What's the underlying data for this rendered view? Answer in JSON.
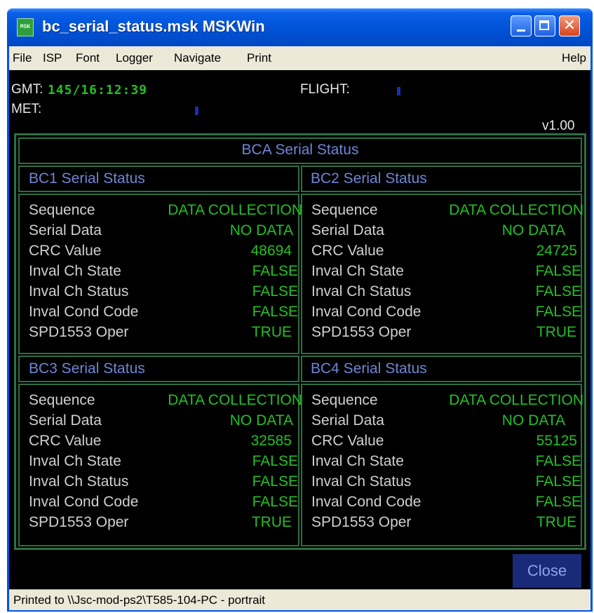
{
  "window": {
    "title": "bc_serial_status.msk MSKWin"
  },
  "menu": {
    "file": "File",
    "isp": "ISP",
    "font": "Font",
    "logger": "Logger",
    "navigate": "Navigate",
    "print": "Print",
    "help": "Help"
  },
  "header": {
    "gmt_label": "GMT:",
    "gmt_value": "145/16:12:39",
    "flight_label": "FLIGHT:",
    "met_label": "MET:",
    "version": "v1.00"
  },
  "panel": {
    "title": "BCA Serial Status",
    "labels": {
      "sequence": "Sequence",
      "serial_data": "Serial Data",
      "crc_value": "CRC Value",
      "inval_ch_state": "Inval Ch State",
      "inval_ch_status": "Inval Ch Status",
      "inval_cond_code": "Inval Cond Code",
      "spd1553_oper": "SPD1553 Oper"
    },
    "sections": [
      {
        "title": "BC1 Serial Status",
        "sequence": "DATA COLLECTION",
        "serial_data": "NO DATA",
        "crc_value": "48694",
        "inval_ch_state": "FALSE",
        "inval_ch_status": "FALSE",
        "inval_cond_code": "FALSE",
        "spd1553_oper": "TRUE"
      },
      {
        "title": "BC2 Serial Status",
        "sequence": "DATA COLLECTION",
        "serial_data": "NO DATA",
        "crc_value": "24725",
        "inval_ch_state": "FALSE",
        "inval_ch_status": "FALSE",
        "inval_cond_code": "FALSE",
        "spd1553_oper": "TRUE"
      },
      {
        "title": "BC3 Serial Status",
        "sequence": "DATA COLLECTION",
        "serial_data": "NO DATA",
        "crc_value": "32585",
        "inval_ch_state": "FALSE",
        "inval_ch_status": "FALSE",
        "inval_cond_code": "FALSE",
        "spd1553_oper": "TRUE"
      },
      {
        "title": "BC4 Serial Status",
        "sequence": "DATA COLLECTION",
        "serial_data": "NO DATA",
        "crc_value": "55125",
        "inval_ch_state": "FALSE",
        "inval_ch_status": "FALSE",
        "inval_cond_code": "FALSE",
        "spd1553_oper": "TRUE"
      }
    ]
  },
  "buttons": {
    "close": "Close"
  },
  "statusbar": {
    "text": "Printed  to \\\\Jsc-mod-ps2\\T585-104-PC - portrait"
  },
  "colors": {
    "title_blue": "#0054e3",
    "value_green": "#22c122",
    "header_blue": "#6f86d6",
    "frame_green": "#2f6e42"
  }
}
